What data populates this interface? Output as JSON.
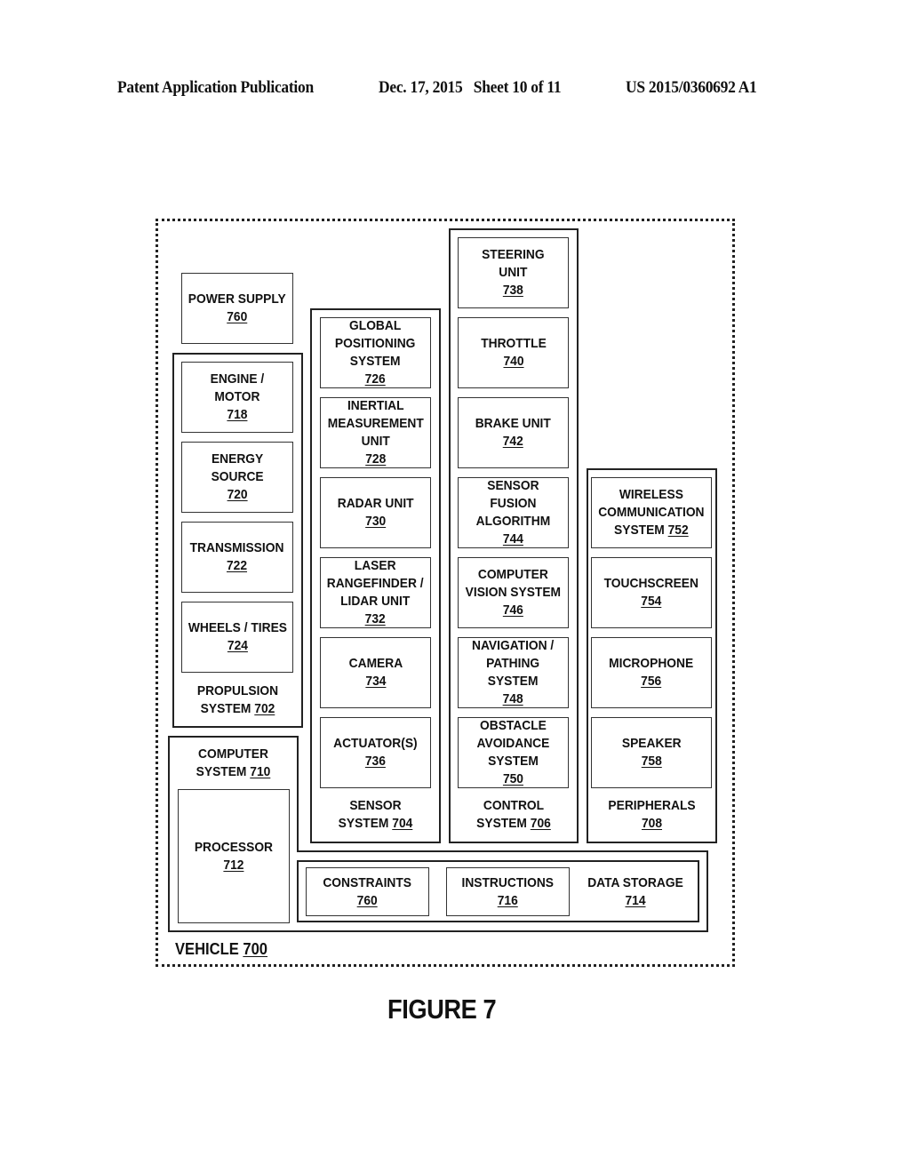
{
  "header": {
    "publication": "Patent Application Publication",
    "date_sheet": "Dec. 17, 2015   Sheet 10 of 11",
    "number": "US 2015/0360692 A1"
  },
  "figure_label": "FIGURE 7",
  "vehicle": {
    "label": "VEHICLE",
    "ref": "700"
  },
  "power_supply": {
    "label": "POWER SUPPLY",
    "ref": "760"
  },
  "propulsion": {
    "label_line1": "PROPULSION",
    "label_line2": "SYSTEM",
    "ref": "702",
    "items": [
      {
        "lines": [
          "ENGINE /",
          "MOTOR"
        ],
        "ref": "718"
      },
      {
        "lines": [
          "ENERGY",
          "SOURCE"
        ],
        "ref": "720"
      },
      {
        "lines": [
          "TRANSMISSION"
        ],
        "ref": "722"
      },
      {
        "lines": [
          "WHEELS / TIRES"
        ],
        "ref": "724"
      }
    ]
  },
  "sensor": {
    "label_line1": "SENSOR",
    "label_line2": "SYSTEM",
    "ref": "704",
    "items": [
      {
        "lines": [
          "GLOBAL",
          "POSITIONING",
          "SYSTEM"
        ],
        "ref": "726"
      },
      {
        "lines": [
          "INERTIAL",
          "MEASUREMENT",
          "UNIT"
        ],
        "ref": "728"
      },
      {
        "lines": [
          "RADAR UNIT"
        ],
        "ref": "730"
      },
      {
        "lines": [
          "LASER",
          "RANGEFINDER /",
          "LIDAR UNIT"
        ],
        "ref": "732"
      },
      {
        "lines": [
          "CAMERA"
        ],
        "ref": "734"
      },
      {
        "lines": [
          "ACTUATOR(S)"
        ],
        "ref": "736"
      }
    ]
  },
  "control": {
    "label_line1": "CONTROL",
    "label_line2": "SYSTEM",
    "ref": "706",
    "items": [
      {
        "lines": [
          "STEERING",
          "UNIT"
        ],
        "ref": "738"
      },
      {
        "lines": [
          "THROTTLE"
        ],
        "ref": "740"
      },
      {
        "lines": [
          "BRAKE UNIT"
        ],
        "ref": "742"
      },
      {
        "lines": [
          "SENSOR",
          "FUSION",
          "ALGORITHM"
        ],
        "ref": "744"
      },
      {
        "lines": [
          "COMPUTER",
          "VISION SYSTEM"
        ],
        "ref": "746"
      },
      {
        "lines": [
          "NAVIGATION /",
          "PATHING",
          "SYSTEM"
        ],
        "ref": "748"
      },
      {
        "lines": [
          "OBSTACLE",
          "AVOIDANCE",
          "SYSTEM"
        ],
        "ref": "750"
      }
    ]
  },
  "peripherals": {
    "label_line1": "PERIPHERALS",
    "label_line2": "",
    "ref": "708",
    "items": [
      {
        "lines": [
          "WIRELESS",
          "COMMUNICATION",
          "SYSTEM"
        ],
        "ref": "752",
        "inline_ref": true
      },
      {
        "lines": [
          "TOUCHSCREEN"
        ],
        "ref": "754"
      },
      {
        "lines": [
          "MICROPHONE"
        ],
        "ref": "756"
      },
      {
        "lines": [
          "SPEAKER"
        ],
        "ref": "758"
      }
    ]
  },
  "computer": {
    "label_line1": "COMPUTER",
    "label_line2": "SYSTEM",
    "ref": "710",
    "processor": {
      "label": "PROCESSOR",
      "ref": "712"
    }
  },
  "data_storage": {
    "label": "DATA STORAGE",
    "ref": "714",
    "items": [
      {
        "lines": [
          "CONSTRAINTS"
        ],
        "ref": "760"
      },
      {
        "lines": [
          "INSTRUCTIONS"
        ],
        "ref": "716"
      }
    ]
  }
}
